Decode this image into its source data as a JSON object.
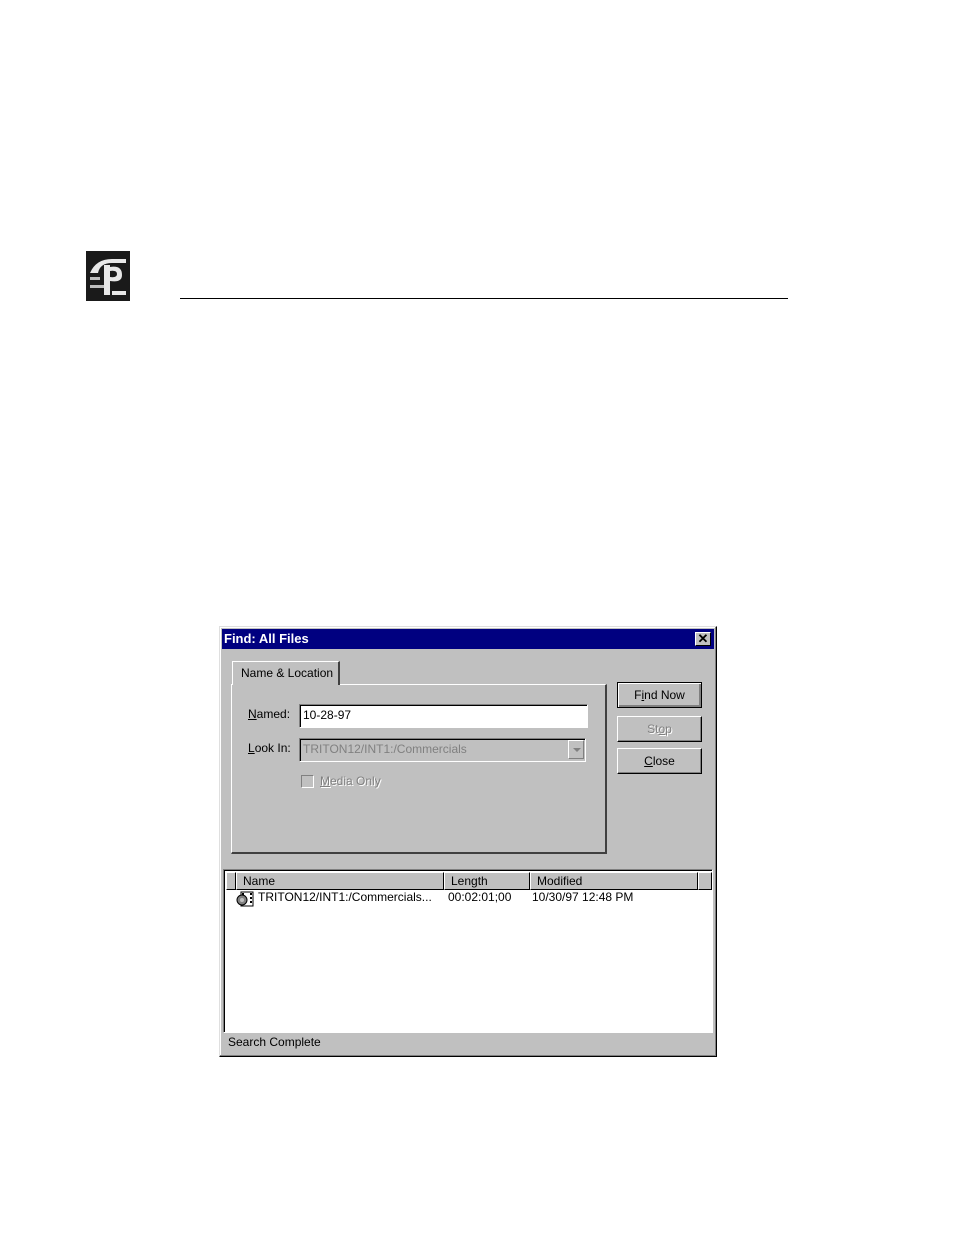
{
  "dialog": {
    "title": "Find: All Files",
    "tab_label": "Name & Location",
    "named_label_accel": "N",
    "named_label_rest": "amed:",
    "named_value": "10-28-97",
    "lookin_label_accel": "L",
    "lookin_label_rest": "ook In:",
    "lookin_value": "TRITON12/INT1:/Commercials",
    "media_only_accel": "M",
    "media_only_rest": "edia Only",
    "find_now_pre": "F",
    "find_now_accel": "i",
    "find_now_post": "nd Now",
    "stop_pre": "St",
    "stop_accel": "o",
    "stop_post": "p",
    "close_accel": "C",
    "close_rest": "lose",
    "columns": [
      "Name",
      "Length",
      "Modified"
    ],
    "rows": [
      {
        "name": "TRITON12/INT1:/Commercials...",
        "length": "00:02:01;00",
        "modified": "10/30/97 12:48 PM"
      }
    ],
    "status": "Search Complete"
  },
  "colors": {
    "titlebar": "#000080",
    "face": "#c0c0c0"
  },
  "icons": [
    "company-logo-icon",
    "close-icon",
    "dropdown-arrow-icon",
    "media-file-icon"
  ]
}
